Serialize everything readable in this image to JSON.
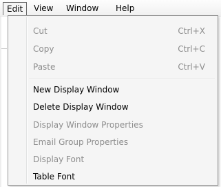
{
  "menubar": {
    "items": [
      {
        "label": "Edit",
        "open": true
      },
      {
        "label": "View"
      },
      {
        "label": "Window"
      },
      {
        "label": "Help"
      }
    ]
  },
  "edit_menu": {
    "items": [
      {
        "label": "Cut",
        "shortcut": "Ctrl+X",
        "enabled": false
      },
      {
        "label": "Copy",
        "shortcut": "Ctrl+C",
        "enabled": false
      },
      {
        "label": "Paste",
        "shortcut": "Ctrl+V",
        "enabled": false
      },
      {
        "label": "New Display Window",
        "enabled": true
      },
      {
        "label": "Delete Display Window",
        "enabled": true
      },
      {
        "label": "Display Window Properties",
        "enabled": false
      },
      {
        "label": "Email Group Properties",
        "enabled": false
      },
      {
        "label": "Display Font",
        "enabled": false
      },
      {
        "label": "Table Font",
        "enabled": true
      }
    ]
  },
  "colors": {
    "disabled_text": "#8d8d8d",
    "menu_background": "#f5f5f5",
    "border": "#979797"
  }
}
